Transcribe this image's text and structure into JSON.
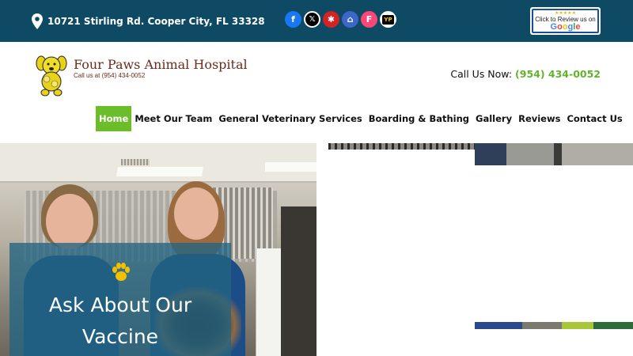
{
  "topbar": {
    "address": "10721 Stirling Rd. Cooper City, FL 33328",
    "social": [
      {
        "name": "facebook-icon",
        "glyph": "f"
      },
      {
        "name": "x-icon",
        "glyph": "𝕏"
      },
      {
        "name": "yelp-icon",
        "glyph": "✱"
      },
      {
        "name": "nextdoor-icon",
        "glyph": "⌂"
      },
      {
        "name": "foursquare-icon",
        "glyph": "F"
      },
      {
        "name": "yellowpages-icon",
        "glyph": "YP"
      }
    ],
    "review_badge": {
      "stars": "★★★★★",
      "line1": "Click to Review us on",
      "brand": "Google"
    },
    "colors": {
      "bar": "#0e4a63"
    }
  },
  "header": {
    "brand": "Four Paws Animal Hospital",
    "brand_sub": "Call us at (954) 434-0052",
    "call_label": "Call Us Now:",
    "phone": "(954) 434-0052",
    "accent": "#62b32c"
  },
  "nav": {
    "items": [
      "Home",
      "Meet Our Team",
      "General Veterinary Services",
      "Boarding & Bathing",
      "Gallery",
      "Reviews",
      "Contact Us"
    ],
    "active": "Home",
    "active_color": "#6bbd2a"
  },
  "hero": {
    "line1": "Ask About Our",
    "line2": "Vaccine",
    "overlay_color": "#23648288"
  }
}
